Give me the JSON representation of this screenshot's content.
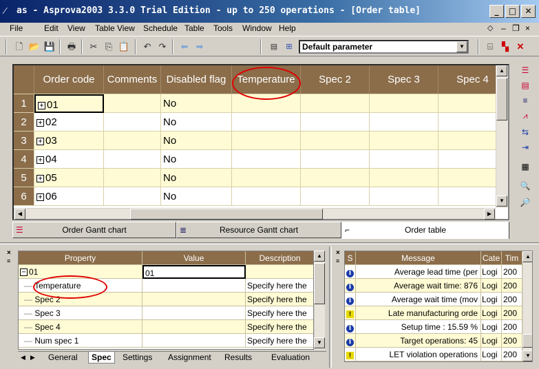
{
  "window": {
    "title": "as - Asprova2003 3.3.0 Trial Edition - up to 250 operations - [Order table]"
  },
  "menu": [
    {
      "label": "File"
    },
    {
      "label": "Edit"
    },
    {
      "label": "View"
    },
    {
      "label": "Table View"
    },
    {
      "label": "Schedule"
    },
    {
      "label": "Table"
    },
    {
      "label": "Tools"
    },
    {
      "label": "Window"
    },
    {
      "label": "Help"
    }
  ],
  "toolbar": {
    "parameter_select": "Default parameter"
  },
  "order_table": {
    "columns": [
      "Order code",
      "Comments",
      "Disabled flag",
      "Temperature",
      "Spec 2",
      "Spec 3",
      "Spec 4"
    ],
    "rows": [
      {
        "num": "1",
        "code": "01",
        "comments": "",
        "disabled": "No"
      },
      {
        "num": "2",
        "code": "02",
        "comments": "",
        "disabled": "No"
      },
      {
        "num": "3",
        "code": "03",
        "comments": "",
        "disabled": "No"
      },
      {
        "num": "4",
        "code": "04",
        "comments": "",
        "disabled": "No"
      },
      {
        "num": "5",
        "code": "05",
        "comments": "",
        "disabled": "No"
      },
      {
        "num": "6",
        "code": "06",
        "comments": "",
        "disabled": "No"
      }
    ]
  },
  "view_tabs": [
    {
      "label": "Order Gantt chart"
    },
    {
      "label": "Resource Gantt chart"
    },
    {
      "label": "Order table"
    }
  ],
  "property_pane": {
    "headers": [
      "Property",
      "Value",
      "Description"
    ],
    "root": {
      "label": "01",
      "value": "01"
    },
    "rows": [
      {
        "prop": "Temperature",
        "value": "",
        "desc": "Specify here the"
      },
      {
        "prop": "Spec 2",
        "value": "",
        "desc": "Specify here the"
      },
      {
        "prop": "Spec 3",
        "value": "",
        "desc": "Specify here the"
      },
      {
        "prop": "Spec 4",
        "value": "",
        "desc": "Specify here the"
      },
      {
        "prop": "Num spec 1",
        "value": "",
        "desc": "Specify here the"
      }
    ],
    "tabs": [
      "General",
      "Spec",
      "Settings",
      "Assignment",
      "Results",
      "Evaluation"
    ]
  },
  "message_pane": {
    "headers": [
      "S",
      "Message",
      "Cate",
      "Tim"
    ],
    "rows": [
      {
        "icon": "info",
        "msg": "Average lead time (per",
        "cat": "Logi",
        "time": "200"
      },
      {
        "icon": "info",
        "msg": "Average wait time: 876",
        "cat": "Logi",
        "time": "200"
      },
      {
        "icon": "info",
        "msg": "Average wait time (mov",
        "cat": "Logi",
        "time": "200"
      },
      {
        "icon": "warn",
        "msg": "Late manufacturing orde",
        "cat": "Logi",
        "time": "200"
      },
      {
        "icon": "info",
        "msg": "Setup time : 15.59 %",
        "cat": "Logi",
        "time": "200"
      },
      {
        "icon": "info",
        "msg": "Target operations: 45",
        "cat": "Logi",
        "time": "200"
      },
      {
        "icon": "warn",
        "msg": "LET violation operations",
        "cat": "Logi",
        "time": "200"
      }
    ]
  },
  "colors": {
    "header_brown": "#8b6d4a",
    "row_yellow": "#fffbd4",
    "highlight_red": "#e00000",
    "title_blue": "#0a246a"
  }
}
